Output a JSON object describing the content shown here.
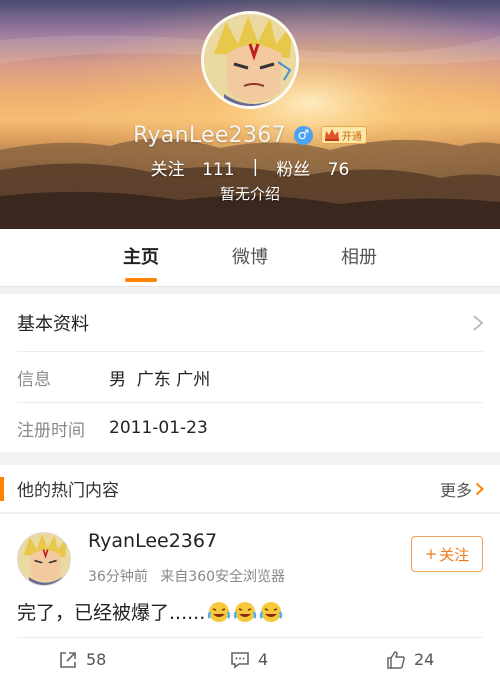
{
  "profile": {
    "username": "RyanLee2367",
    "gender_symbol": "♂",
    "vip_label": "开通",
    "following_label": "关注",
    "following_count": "111",
    "separator": "|",
    "followers_label": "粉丝",
    "followers_count": "76",
    "bio": "暂无介绍"
  },
  "tabs": [
    {
      "label": "主页",
      "active": true
    },
    {
      "label": "微博",
      "active": false
    },
    {
      "label": "相册",
      "active": false
    }
  ],
  "basic_info": {
    "title": "基本资料",
    "rows": [
      {
        "label": "信息",
        "value": "男  广东 广州"
      },
      {
        "label": "注册时间",
        "value": "2011-01-23"
      }
    ]
  },
  "hot": {
    "title": "他的热门内容",
    "more_label": "更多"
  },
  "post": {
    "author": "RyanLee2367",
    "time": "36分钟前",
    "source": "来自360安全浏览器",
    "follow_label": "关注",
    "follow_plus": "+",
    "text": "完了，已经被爆了......",
    "emoji_count": 3,
    "reposts": "58",
    "comments": "4",
    "likes": "24"
  },
  "colors": {
    "accent": "#ff8200",
    "gender_blue": "#4aa3f0",
    "follow_orange": "#f07b18"
  },
  "icons": {
    "gender": "male-icon",
    "vip": "crown-icon",
    "chevron": "chevron-right-icon",
    "repost": "repost-icon",
    "comment": "comment-icon",
    "like": "thumb-up-icon",
    "emoji": "laugh-cry-emoji-icon"
  }
}
